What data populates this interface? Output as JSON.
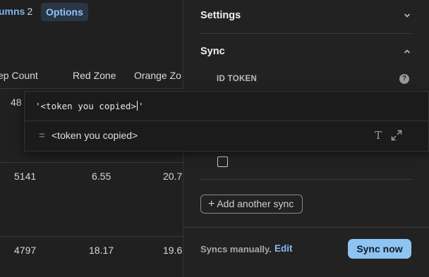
{
  "toolbar": {
    "columns_label": "umns",
    "columns_count": "2",
    "options_label": "Options"
  },
  "table": {
    "headers": [
      "ep Count",
      "Red Zone",
      "Orange Zo"
    ],
    "rows": [
      [
        "48",
        "",
        ""
      ],
      [
        "5141",
        "6.55",
        "20.7"
      ],
      [
        "4797",
        "18.17",
        "19.6"
      ]
    ]
  },
  "formula": {
    "input_text_before_caret": "'<token you copied>",
    "input_text_after_caret": "'",
    "suggestion_symbol": "=",
    "suggestion_text": "<token you copied>",
    "icons": [
      "text-type-icon",
      "expand-icon"
    ]
  },
  "panel": {
    "settings_title": "Settings",
    "sync_title": "Sync",
    "id_token_label": "ID TOKEN",
    "help_symbol": "?",
    "add_sync_label": "Add another sync",
    "syncs_status": "Syncs manually.",
    "edit_label": "Edit",
    "sync_now_label": "Sync now"
  },
  "colors": {
    "accent": "#8ec3f2",
    "link": "#86baf1",
    "background": "#202020"
  }
}
